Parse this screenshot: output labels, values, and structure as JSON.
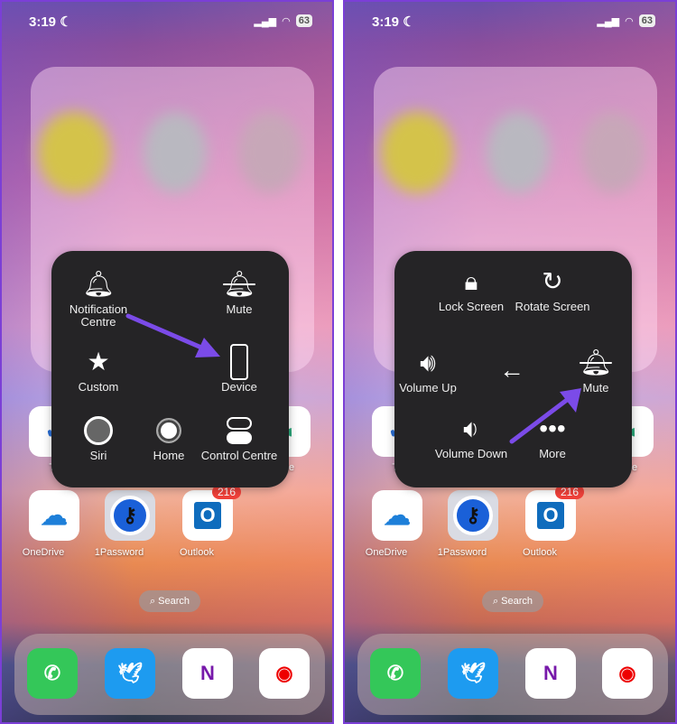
{
  "status": {
    "time": "3:19",
    "battery": "63"
  },
  "apps": {
    "todo_partial": "To",
    "edge_partial": "ge",
    "onedrive": "OneDrive",
    "onepassword": "1Password",
    "outlook": "Outlook",
    "outlook_badge": "216",
    "search": "Search"
  },
  "left_menu": {
    "items": [
      "Notification Centre",
      "Mute",
      "Custom",
      "Device",
      "Siri",
      "Home",
      "Control Centre"
    ]
  },
  "right_menu": {
    "items": [
      "Lock Screen",
      "Rotate Screen",
      "Volume Up",
      "Mute",
      "Volume Down",
      "More"
    ]
  },
  "colors": {
    "arrow": "#7b4be8",
    "menu_bg": "#252426"
  }
}
